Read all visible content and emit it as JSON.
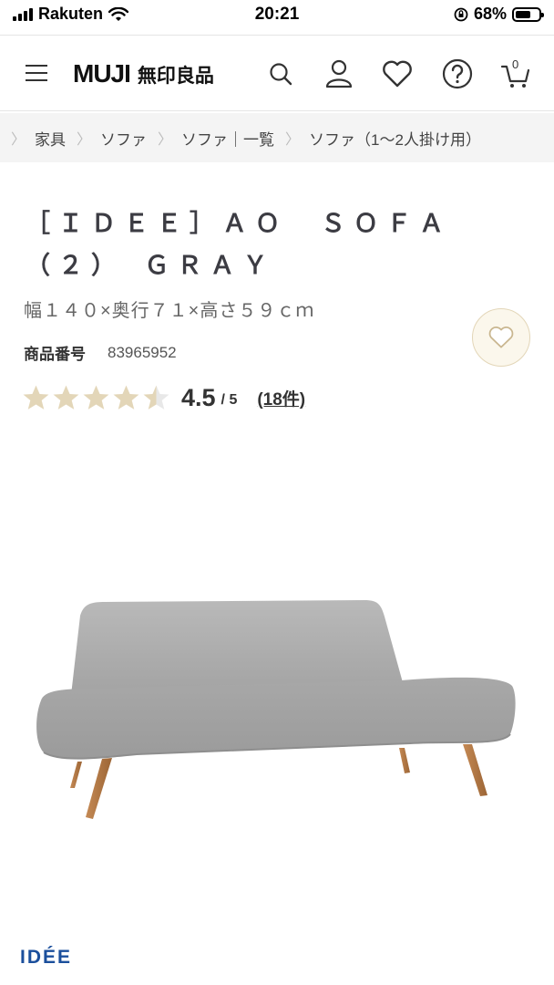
{
  "status_bar": {
    "carrier": "Rakuten",
    "time": "20:21",
    "battery_percent": "68%",
    "battery_level": 0.68,
    "icons": [
      "signal-icon",
      "wifi-icon",
      "orientation-lock-icon",
      "battery-icon"
    ]
  },
  "header": {
    "logo_en": "MUJI",
    "logo_jp": "無印良品",
    "cart_count": "0",
    "icons": [
      "menu-icon",
      "search-icon",
      "account-icon",
      "favorite-icon",
      "help-icon",
      "cart-icon"
    ]
  },
  "breadcrumb": [
    "家具",
    "ソファ",
    "ソファ｜一覧",
    "ソファ（1〜2人掛け用）"
  ],
  "product": {
    "title": "［ＩＤＥＥ］ＡＯ　ＳＯＦＡ　（２）　ＧＲＡＹ",
    "size": "幅１４０×奥行７１×高さ５９ｃｍ",
    "code_label": "商品番号",
    "code_value": "83965952",
    "rating_score": "4.5",
    "rating_max": "/ 5",
    "rating_value": 4.5,
    "review_count": "(18件)"
  },
  "colors": {
    "star": "#e3d6b8",
    "star_empty": "#e8e8e8",
    "brand_blue": "#1b4f9c"
  },
  "brand_mark": "IDÉE"
}
